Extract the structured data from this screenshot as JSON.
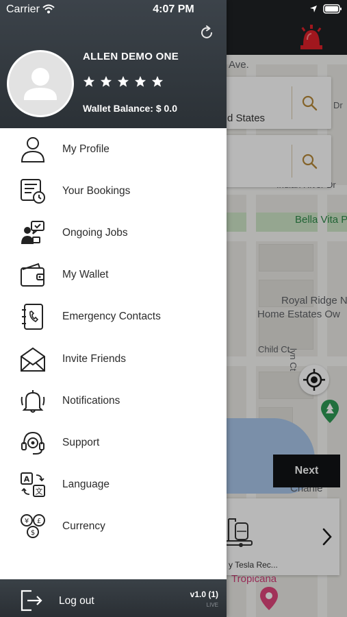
{
  "status_bar": {
    "carrier": "Carrier",
    "time": "4:07 PM"
  },
  "drawer": {
    "user": {
      "name": "ALLEN DEMO ONE",
      "rating": 5,
      "wallet_balance": "Wallet Balance: $ 0.0"
    },
    "menu": [
      {
        "label": "My Profile",
        "icon": "person-icon"
      },
      {
        "label": "Your Bookings",
        "icon": "bookings-icon"
      },
      {
        "label": "Ongoing Jobs",
        "icon": "ongoing-jobs-icon"
      },
      {
        "label": "My Wallet",
        "icon": "wallet-icon"
      },
      {
        "label": "Emergency Contacts",
        "icon": "emergency-contacts-icon"
      },
      {
        "label": "Invite Friends",
        "icon": "envelope-icon"
      },
      {
        "label": "Notifications",
        "icon": "bell-icon"
      },
      {
        "label": "Support",
        "icon": "support-headset-icon"
      },
      {
        "label": "Language",
        "icon": "language-icon"
      },
      {
        "label": "Currency",
        "icon": "currency-icon"
      }
    ],
    "footer": {
      "logout_label": "Log out",
      "version": "v1.0 (1)",
      "environment": "LIVE"
    }
  },
  "map": {
    "labels": {
      "street_top": "Ave.",
      "street_dr": "Dr",
      "indian_river": "Indian River Dr",
      "bella_vita": "Bella Vita P",
      "royal_ridge_1": "Royal Ridge N",
      "royal_ridge_2": "Home Estates Ow",
      "child_ct": "Child Ct",
      "lyn_ct": "lyn Ct",
      "charlie": "Charlie",
      "tropicana": "Tropicana"
    },
    "pickup_text": "d States",
    "next_label": "Next",
    "vehicle_name": "y Tesla Rec..."
  },
  "colors": {
    "header_dark": "#2b3136",
    "accent_red": "#e0202a",
    "map_green": "#2f8a4a"
  }
}
